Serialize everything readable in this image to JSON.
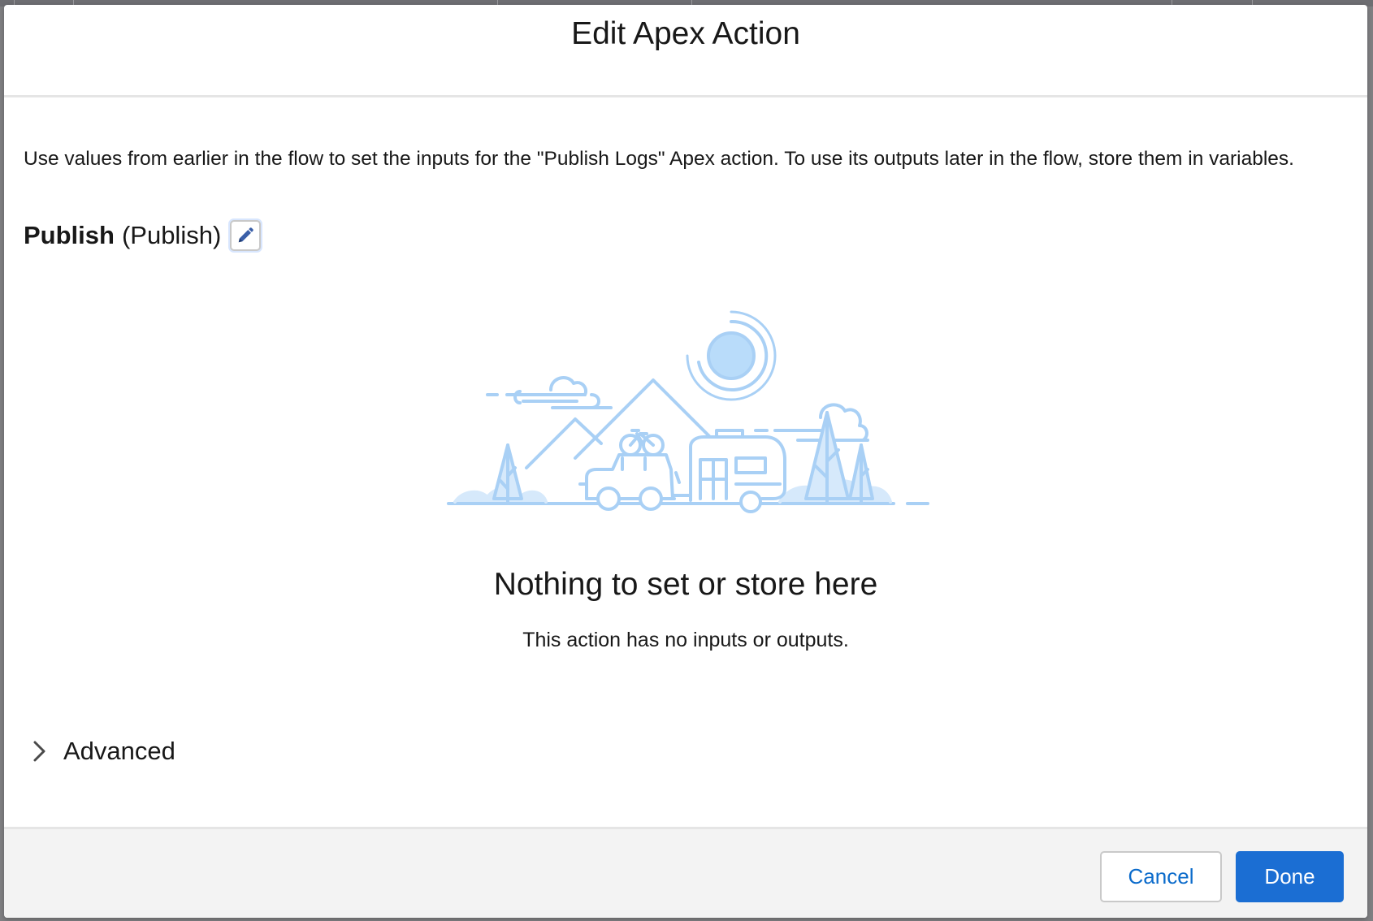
{
  "modal": {
    "title": "Edit Apex Action",
    "description": "Use values from earlier in the flow to set the inputs for the \"Publish Logs\" Apex action. To use its outputs later in the flow, store them in variables.",
    "action": {
      "name": "Publish",
      "api_name": "(Publish)",
      "edit_icon": "pencil-icon"
    },
    "empty_state": {
      "illustration": "camping-trailer-illustration",
      "title": "Nothing to set or store here",
      "subtitle": "This action has no inputs or outputs."
    },
    "advanced": {
      "label": "Advanced",
      "icon": "chevron-right-icon"
    }
  },
  "footer": {
    "cancel_label": "Cancel",
    "done_label": "Done"
  },
  "colors": {
    "brand": "#1b6ed3",
    "link": "#0b6bcb",
    "illustration_stroke": "#a9d0f5",
    "illustration_fill": "#d6e9fb",
    "footer_bg": "#f3f3f3"
  }
}
